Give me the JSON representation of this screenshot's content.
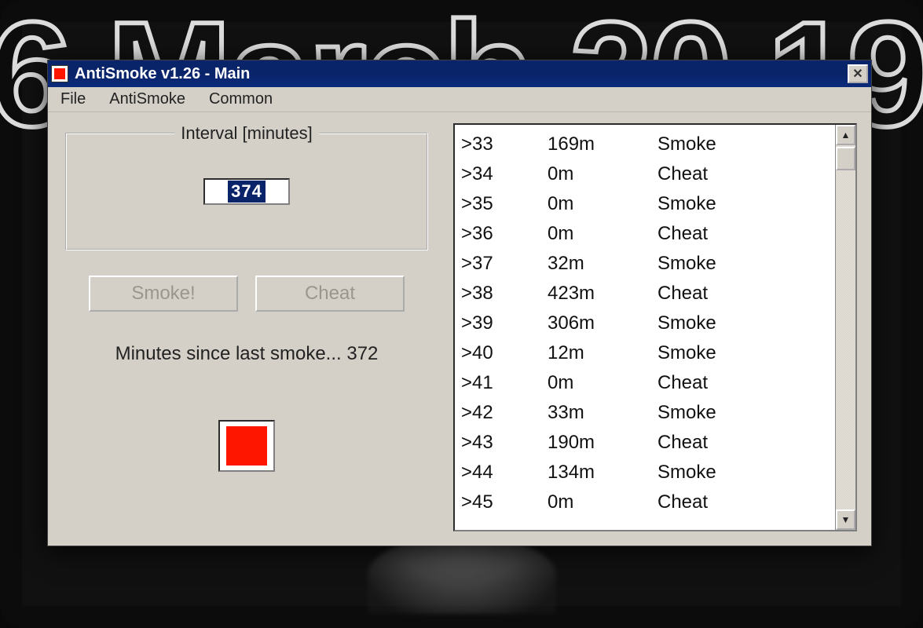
{
  "background_text": "6 March 20   19",
  "window": {
    "title": "AntiSmoke v1.26 - Main",
    "menus": {
      "file": "File",
      "antismoke": "AntiSmoke",
      "common": "Common"
    },
    "close_glyph": "✕",
    "interval_group_label": "Interval [minutes]",
    "interval_value": "374",
    "smoke_button": "Smoke!",
    "cheat_button": "Cheat",
    "status_prefix": "Minutes since last smoke... ",
    "status_value": "372",
    "indicator_color": "#ff1600"
  },
  "log": [
    {
      "n": ">33",
      "t": "169m",
      "a": "Smoke"
    },
    {
      "n": ">34",
      "t": "0m",
      "a": "Cheat"
    },
    {
      "n": ">35",
      "t": "0m",
      "a": "Smoke"
    },
    {
      "n": ">36",
      "t": "0m",
      "a": "Cheat"
    },
    {
      "n": ">37",
      "t": "32m",
      "a": "Smoke"
    },
    {
      "n": ">38",
      "t": "423m",
      "a": "Cheat"
    },
    {
      "n": ">39",
      "t": "306m",
      "a": "Smoke"
    },
    {
      "n": ">40",
      "t": "12m",
      "a": "Smoke"
    },
    {
      "n": ">41",
      "t": "0m",
      "a": "Cheat"
    },
    {
      "n": ">42",
      "t": "33m",
      "a": "Smoke"
    },
    {
      "n": ">43",
      "t": "190m",
      "a": "Cheat"
    },
    {
      "n": ">44",
      "t": "134m",
      "a": "Smoke"
    },
    {
      "n": ">45",
      "t": "0m",
      "a": "Cheat"
    }
  ],
  "scroll": {
    "up": "▲",
    "down": "▼"
  }
}
